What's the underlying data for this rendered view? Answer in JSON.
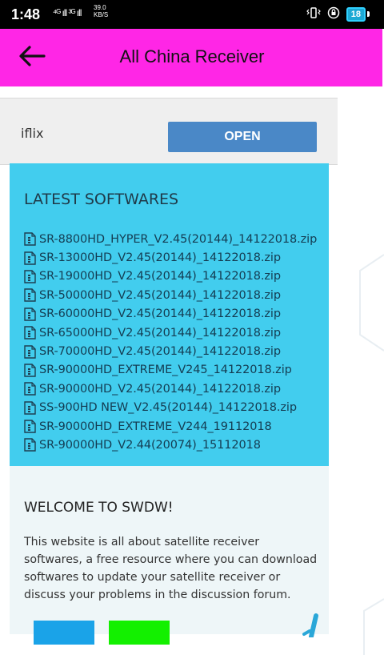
{
  "status_bar": {
    "time": "1:48",
    "signal_text": "⁴ᴳ ıll ³ᴳ ıll",
    "speed_value": "39.0",
    "speed_unit": "KB/S",
    "battery_level": "18",
    "icons": [
      "vibrate-icon",
      "lock-rotation-icon",
      "battery-icon"
    ]
  },
  "app_bar": {
    "title": "All China Receiver",
    "back_icon": "back-arrow-icon",
    "color": "#ff26e6"
  },
  "iflix_card": {
    "label": "iflix",
    "button_label": "OPEN"
  },
  "latest_softwares": {
    "title": "LATEST SOFTWARES",
    "items": [
      "SR-8800HD_HYPER_V2.45(20144)_14122018.zip",
      "SR-13000HD_V2.45(20144)_14122018.zip",
      "SR-19000HD_V2.45(20144)_14122018.zip",
      "SR-50000HD_V2.45(20144)_14122018.zip",
      "SR-60000HD_V2.45(20144)_14122018.zip",
      "SR-65000HD_V2.45(20144)_14122018.zip",
      "SR-70000HD_V2.45(20144)_14122018.zip",
      "SR-90000HD_EXTREME_V245_14122018.zip",
      "SR-90000HD_V2.45(20144)_14122018.zip",
      "SS-900HD NEW_V2.45(20144)_14122018.zip",
      "SR-90000HD_EXTREME_V244_19112018",
      "SR-90000HD_V2.44(20074)_15112018"
    ],
    "item_icon": "file-archive-icon"
  },
  "welcome": {
    "title": "WELCOME TO SWDW!",
    "text": "This website is all about satellite receiver softwares, a free resource where you can download softwares to update your satellite receiver or discuss your problems in the discussion forum."
  }
}
